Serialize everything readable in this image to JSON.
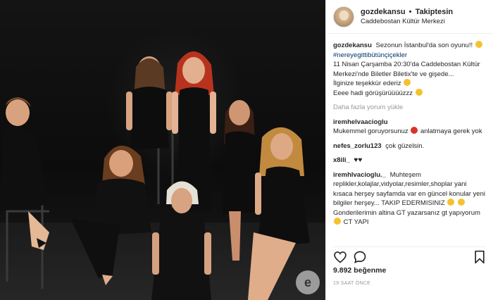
{
  "post": {
    "username": "gozdekansu",
    "separator": "•",
    "follow_state": "Takiptesin",
    "location": "Caddebostan Kültür Merkezi"
  },
  "caption": {
    "username": "gozdekansu",
    "line1": "Sezonun İstanbul'da son oyunu!!",
    "hashtag": "#nereyegittibütünçiçekler",
    "line2": "11 Nisan Çarşamba 20:30'da Caddebostan Kültür Merkezi'nde Biletler Biletix'te ve gişede...",
    "line3": "İlginize teşekkür ederiz",
    "line4": "Eeee hadi görüşürüüüüzzz"
  },
  "load_more": "Daha fazla yorum yükle",
  "comments": [
    {
      "username": "iremhelvaacioglu",
      "text": "Mukemmel goruyorsunuz",
      "text_after": "anlatmaya gerek yok"
    },
    {
      "username": "nefes_zorlu123",
      "text": "çok güzelsin."
    },
    {
      "username": "x8ili_",
      "text": ""
    },
    {
      "username": "iremhlvacioglu._",
      "text": "Muhteşem replikler,kolajlar,vidyolar,resimler,shoplar yani kısaca herşey sayfamda var en güncel konular yeni bilgiler herşey... TAKIP EDERMISINIZ",
      "text_after": "Gonderilerimin altina GT yazarsanız gt yapıyorum",
      "text_end": "CT YAPI"
    }
  ],
  "icons": {
    "like": "heart-icon",
    "comment": "comment-icon",
    "save": "bookmark-icon"
  },
  "likes": {
    "count": "9.892",
    "label": "beğenme"
  },
  "timestamp": "19 SAAT ÖNCE",
  "watermark_letter": "e",
  "colors": {
    "text": "#262626",
    "hashtag": "#003569",
    "muted": "#999999",
    "border": "#efefef"
  }
}
